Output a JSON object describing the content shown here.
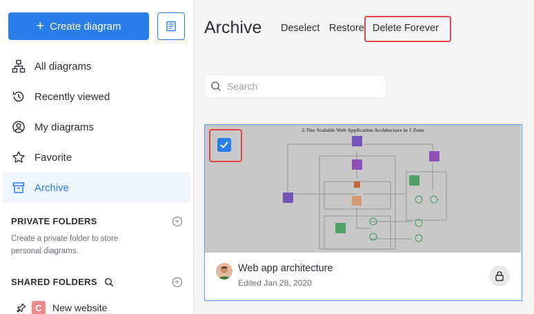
{
  "sidebar": {
    "create_label": "Create diagram",
    "nav": [
      {
        "label": "All diagrams",
        "icon": "sitemap-icon"
      },
      {
        "label": "Recently viewed",
        "icon": "history-icon"
      },
      {
        "label": "My diagrams",
        "icon": "user-circle-icon"
      },
      {
        "label": "Favorite",
        "icon": "star-icon"
      },
      {
        "label": "Archive",
        "icon": "archive-icon",
        "active": true
      }
    ],
    "private_folders": {
      "title": "PRIVATE FOLDERS",
      "description": "Create a private folder to store personal diagrams."
    },
    "shared_folders": {
      "title": "SHARED FOLDERS",
      "items": [
        {
          "label": "New website",
          "logo_letter": "C"
        }
      ]
    }
  },
  "main": {
    "title": "Archive",
    "actions": {
      "deselect": "Deselect",
      "restore": "Restore",
      "delete_forever": "Delete Forever"
    },
    "search": {
      "placeholder": "Search",
      "value": ""
    },
    "cards": [
      {
        "name": "Web app architecture",
        "edited": "Edited Jan 28, 2020",
        "selected": true,
        "thumbnail_title": "2-Tier Scalable Web Application Architecture in 1 Zone"
      }
    ]
  },
  "colors": {
    "accent": "#2b7de9",
    "highlight": "#e04646",
    "active_bg": "#eef5fd"
  }
}
